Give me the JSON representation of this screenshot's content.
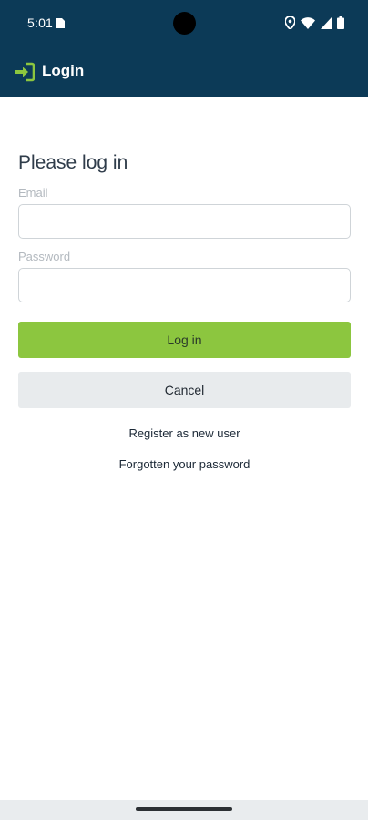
{
  "status_bar": {
    "time": "5:01"
  },
  "app_bar": {
    "title": "Login",
    "icon": "login-icon",
    "icon_color": "#8cc63f",
    "background": "#0c3a57"
  },
  "form": {
    "heading": "Please log in",
    "email": {
      "label": "Email",
      "value": ""
    },
    "password": {
      "label": "Password",
      "value": ""
    },
    "login_button": "Log in",
    "cancel_button": "Cancel",
    "register_link": "Register as new user",
    "forgot_link": "Forgotten your password"
  },
  "colors": {
    "accent": "#8cc63f",
    "secondary_button": "#e8ebed"
  }
}
